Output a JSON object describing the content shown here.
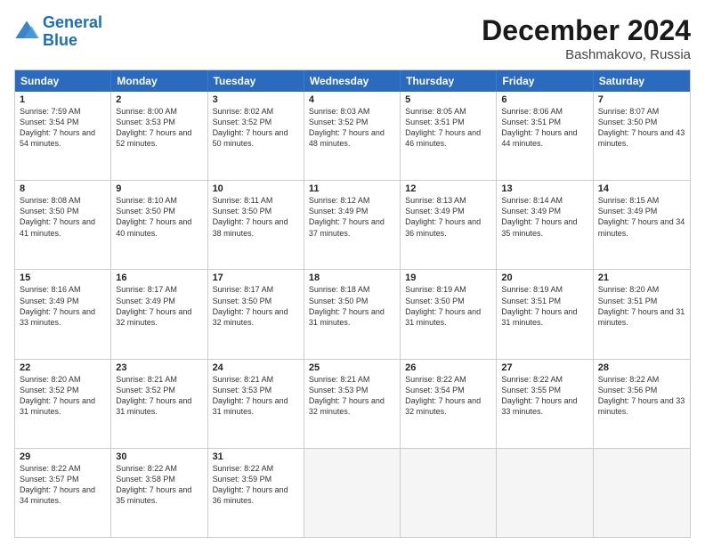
{
  "header": {
    "logo_line1": "General",
    "logo_line2": "Blue",
    "month": "December 2024",
    "location": "Bashmakovo, Russia"
  },
  "weekdays": [
    "Sunday",
    "Monday",
    "Tuesday",
    "Wednesday",
    "Thursday",
    "Friday",
    "Saturday"
  ],
  "weeks": [
    [
      {
        "day": "1",
        "sunrise": "Sunrise: 7:59 AM",
        "sunset": "Sunset: 3:54 PM",
        "daylight": "Daylight: 7 hours and 54 minutes."
      },
      {
        "day": "2",
        "sunrise": "Sunrise: 8:00 AM",
        "sunset": "Sunset: 3:53 PM",
        "daylight": "Daylight: 7 hours and 52 minutes."
      },
      {
        "day": "3",
        "sunrise": "Sunrise: 8:02 AM",
        "sunset": "Sunset: 3:52 PM",
        "daylight": "Daylight: 7 hours and 50 minutes."
      },
      {
        "day": "4",
        "sunrise": "Sunrise: 8:03 AM",
        "sunset": "Sunset: 3:52 PM",
        "daylight": "Daylight: 7 hours and 48 minutes."
      },
      {
        "day": "5",
        "sunrise": "Sunrise: 8:05 AM",
        "sunset": "Sunset: 3:51 PM",
        "daylight": "Daylight: 7 hours and 46 minutes."
      },
      {
        "day": "6",
        "sunrise": "Sunrise: 8:06 AM",
        "sunset": "Sunset: 3:51 PM",
        "daylight": "Daylight: 7 hours and 44 minutes."
      },
      {
        "day": "7",
        "sunrise": "Sunrise: 8:07 AM",
        "sunset": "Sunset: 3:50 PM",
        "daylight": "Daylight: 7 hours and 43 minutes."
      }
    ],
    [
      {
        "day": "8",
        "sunrise": "Sunrise: 8:08 AM",
        "sunset": "Sunset: 3:50 PM",
        "daylight": "Daylight: 7 hours and 41 minutes."
      },
      {
        "day": "9",
        "sunrise": "Sunrise: 8:10 AM",
        "sunset": "Sunset: 3:50 PM",
        "daylight": "Daylight: 7 hours and 40 minutes."
      },
      {
        "day": "10",
        "sunrise": "Sunrise: 8:11 AM",
        "sunset": "Sunset: 3:50 PM",
        "daylight": "Daylight: 7 hours and 38 minutes."
      },
      {
        "day": "11",
        "sunrise": "Sunrise: 8:12 AM",
        "sunset": "Sunset: 3:49 PM",
        "daylight": "Daylight: 7 hours and 37 minutes."
      },
      {
        "day": "12",
        "sunrise": "Sunrise: 8:13 AM",
        "sunset": "Sunset: 3:49 PM",
        "daylight": "Daylight: 7 hours and 36 minutes."
      },
      {
        "day": "13",
        "sunrise": "Sunrise: 8:14 AM",
        "sunset": "Sunset: 3:49 PM",
        "daylight": "Daylight: 7 hours and 35 minutes."
      },
      {
        "day": "14",
        "sunrise": "Sunrise: 8:15 AM",
        "sunset": "Sunset: 3:49 PM",
        "daylight": "Daylight: 7 hours and 34 minutes."
      }
    ],
    [
      {
        "day": "15",
        "sunrise": "Sunrise: 8:16 AM",
        "sunset": "Sunset: 3:49 PM",
        "daylight": "Daylight: 7 hours and 33 minutes."
      },
      {
        "day": "16",
        "sunrise": "Sunrise: 8:17 AM",
        "sunset": "Sunset: 3:49 PM",
        "daylight": "Daylight: 7 hours and 32 minutes."
      },
      {
        "day": "17",
        "sunrise": "Sunrise: 8:17 AM",
        "sunset": "Sunset: 3:50 PM",
        "daylight": "Daylight: 7 hours and 32 minutes."
      },
      {
        "day": "18",
        "sunrise": "Sunrise: 8:18 AM",
        "sunset": "Sunset: 3:50 PM",
        "daylight": "Daylight: 7 hours and 31 minutes."
      },
      {
        "day": "19",
        "sunrise": "Sunrise: 8:19 AM",
        "sunset": "Sunset: 3:50 PM",
        "daylight": "Daylight: 7 hours and 31 minutes."
      },
      {
        "day": "20",
        "sunrise": "Sunrise: 8:19 AM",
        "sunset": "Sunset: 3:51 PM",
        "daylight": "Daylight: 7 hours and 31 minutes."
      },
      {
        "day": "21",
        "sunrise": "Sunrise: 8:20 AM",
        "sunset": "Sunset: 3:51 PM",
        "daylight": "Daylight: 7 hours and 31 minutes."
      }
    ],
    [
      {
        "day": "22",
        "sunrise": "Sunrise: 8:20 AM",
        "sunset": "Sunset: 3:52 PM",
        "daylight": "Daylight: 7 hours and 31 minutes."
      },
      {
        "day": "23",
        "sunrise": "Sunrise: 8:21 AM",
        "sunset": "Sunset: 3:52 PM",
        "daylight": "Daylight: 7 hours and 31 minutes."
      },
      {
        "day": "24",
        "sunrise": "Sunrise: 8:21 AM",
        "sunset": "Sunset: 3:53 PM",
        "daylight": "Daylight: 7 hours and 31 minutes."
      },
      {
        "day": "25",
        "sunrise": "Sunrise: 8:21 AM",
        "sunset": "Sunset: 3:53 PM",
        "daylight": "Daylight: 7 hours and 32 minutes."
      },
      {
        "day": "26",
        "sunrise": "Sunrise: 8:22 AM",
        "sunset": "Sunset: 3:54 PM",
        "daylight": "Daylight: 7 hours and 32 minutes."
      },
      {
        "day": "27",
        "sunrise": "Sunrise: 8:22 AM",
        "sunset": "Sunset: 3:55 PM",
        "daylight": "Daylight: 7 hours and 33 minutes."
      },
      {
        "day": "28",
        "sunrise": "Sunrise: 8:22 AM",
        "sunset": "Sunset: 3:56 PM",
        "daylight": "Daylight: 7 hours and 33 minutes."
      }
    ],
    [
      {
        "day": "29",
        "sunrise": "Sunrise: 8:22 AM",
        "sunset": "Sunset: 3:57 PM",
        "daylight": "Daylight: 7 hours and 34 minutes."
      },
      {
        "day": "30",
        "sunrise": "Sunrise: 8:22 AM",
        "sunset": "Sunset: 3:58 PM",
        "daylight": "Daylight: 7 hours and 35 minutes."
      },
      {
        "day": "31",
        "sunrise": "Sunrise: 8:22 AM",
        "sunset": "Sunset: 3:59 PM",
        "daylight": "Daylight: 7 hours and 36 minutes."
      },
      {
        "day": "",
        "sunrise": "",
        "sunset": "",
        "daylight": ""
      },
      {
        "day": "",
        "sunrise": "",
        "sunset": "",
        "daylight": ""
      },
      {
        "day": "",
        "sunrise": "",
        "sunset": "",
        "daylight": ""
      },
      {
        "day": "",
        "sunrise": "",
        "sunset": "",
        "daylight": ""
      }
    ]
  ]
}
